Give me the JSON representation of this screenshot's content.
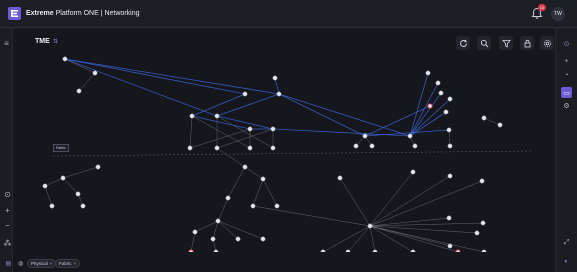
{
  "app": {
    "brand": "Extreme",
    "product": "Platform ONE | Networking",
    "user_initials": "TW",
    "notification_count": "10"
  },
  "canvas": {
    "title": "TME"
  },
  "filters": {
    "chips": [
      {
        "label": "Physical"
      },
      {
        "label": "Fabric"
      }
    ]
  },
  "topology": {
    "legend_label": "Fabric"
  },
  "colors": {
    "accent": "#6b5cd6",
    "link_fabric": "#3d63d8",
    "link_physical": "#c9ccd4",
    "alert": "#d9384a"
  }
}
